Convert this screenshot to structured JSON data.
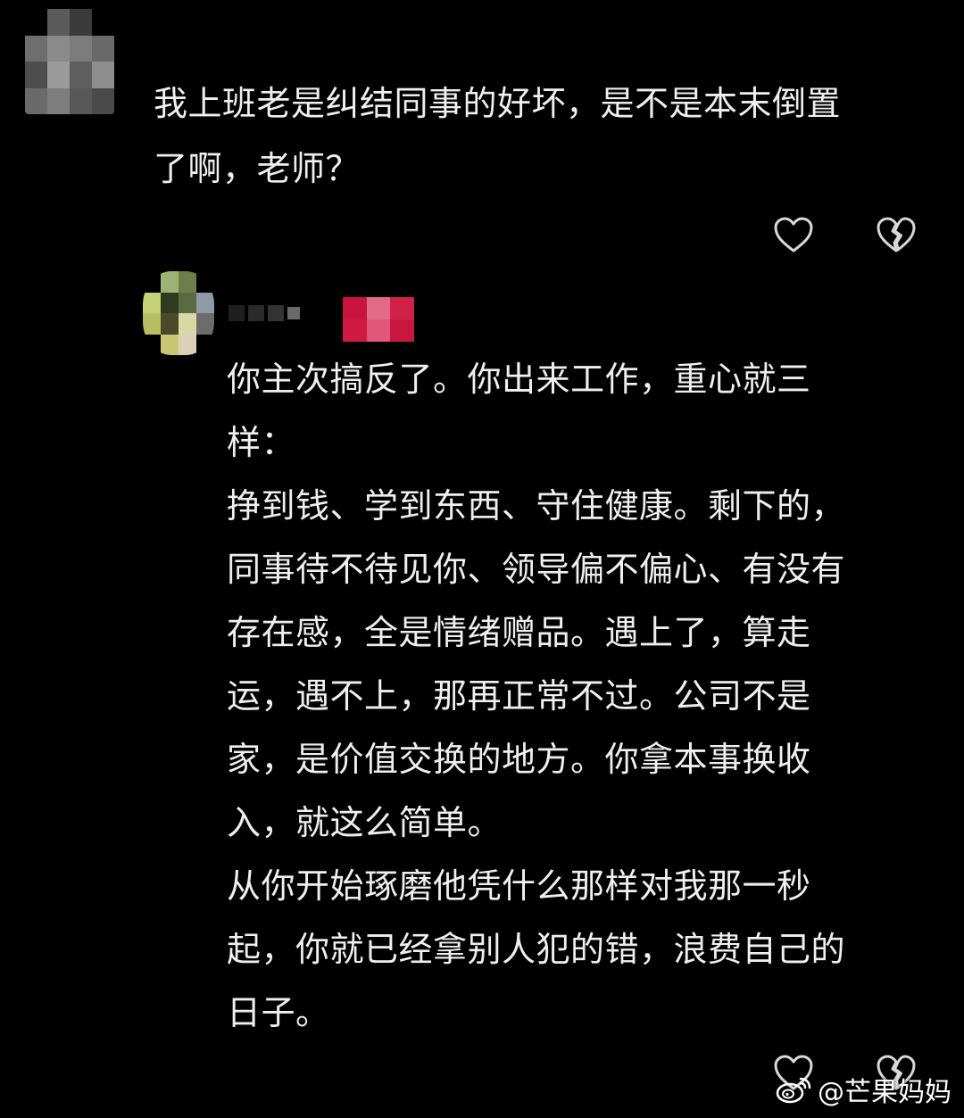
{
  "colors": {
    "background": "#000000",
    "text": "#efefef",
    "icon_stroke": "#d8d8d8"
  },
  "comment": {
    "text": "我上班老是纠结同事的好坏，是不是本末倒置\n了啊，老师？",
    "like_icon": "heart-outline-icon",
    "dislike_icon": "broken-heart-icon"
  },
  "reply": {
    "text": "你主次搞反了。你出来工作，重心就三\n样：\n挣到钱、学到东西、守住健康。剩下的，\n同事待不待见你、领导偏不偏心、有没有\n存在感，全是情绪赠品。遇上了，算走\n运，遇不上，那再正常不过。公司不是\n家，是价值交换的地方。你拿本事换收\n入，就这么简单。\n从你开始琢磨他凭什么那样对我那一秒\n起，你就已经拿别人犯的错，浪费自己的\n日子。",
    "like_icon": "heart-outline-icon",
    "dislike_icon": "broken-heart-icon"
  },
  "watermark": {
    "logo_icon": "weibo-logo-icon",
    "text": "@芒果妈妈"
  }
}
